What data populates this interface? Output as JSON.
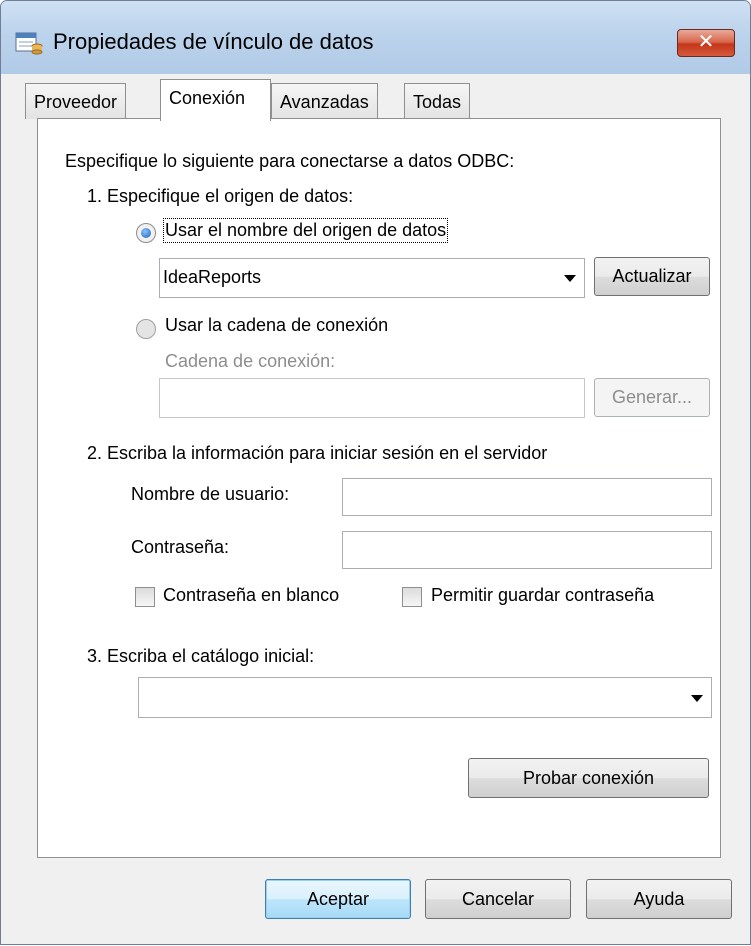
{
  "window": {
    "title": "Propiedades de vínculo de datos",
    "close_label": "✕"
  },
  "tabs": [
    {
      "label": "Proveedor",
      "active": false
    },
    {
      "label": "Conexión",
      "active": true
    },
    {
      "label": "Avanzadas",
      "active": false
    },
    {
      "label": "Todas",
      "active": false
    }
  ],
  "connection": {
    "intro": "Especifique lo siguiente para conectarse a datos ODBC:",
    "step1": {
      "label": "1. Especifique el origen de datos:",
      "radio_dsn": {
        "label": "Usar el nombre del origen de datos",
        "checked": true
      },
      "dsn_value": "IdeaReports",
      "refresh_button": "Actualizar",
      "radio_connstr": {
        "label": "Usar la cadena de conexión",
        "checked": false
      },
      "connstr_label": "Cadena de conexión:",
      "connstr_value": "",
      "build_button": "Generar..."
    },
    "step2": {
      "label": "2. Escriba la información para iniciar sesión en el servidor",
      "username_label": "Nombre de usuario:",
      "username_value": "",
      "password_label": "Contraseña:",
      "password_value": "",
      "blank_password": {
        "label": "Contraseña en blanco",
        "checked": false
      },
      "allow_save": {
        "label": "Permitir guardar contraseña",
        "checked": false
      }
    },
    "step3": {
      "label": "3. Escriba el catálogo inicial:",
      "catalog_value": ""
    },
    "test_button": "Probar conexión"
  },
  "footer": {
    "ok": "Aceptar",
    "cancel": "Cancelar",
    "help": "Ayuda"
  }
}
